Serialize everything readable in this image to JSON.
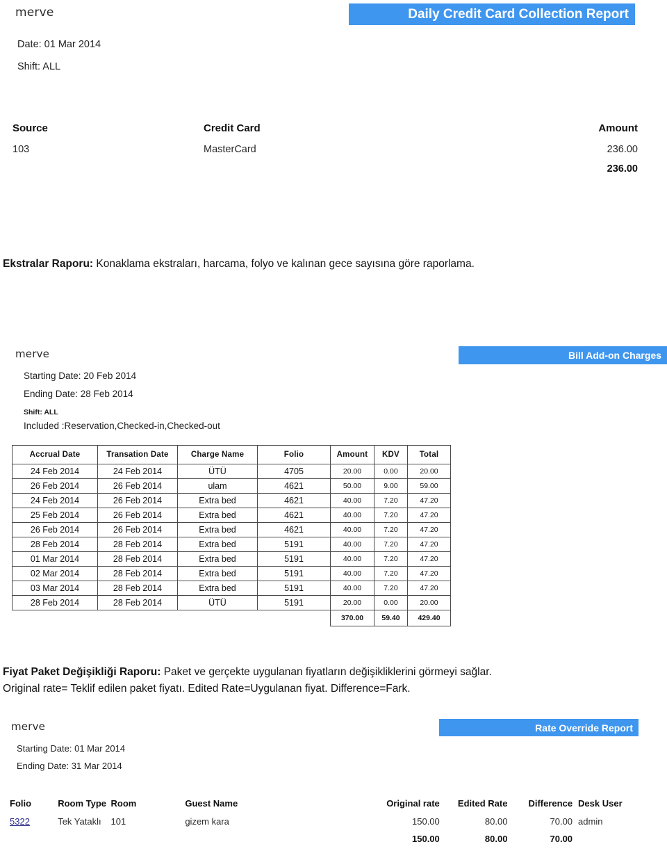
{
  "report1": {
    "logo": "merve",
    "banner_title": "Daily Credit Card Collection Report",
    "date_line": "Date: 01 Mar 2014",
    "shift_line": "Shift: ALL",
    "columns": [
      "Source",
      "Credit Card",
      "Amount"
    ],
    "rows": [
      {
        "source": "103",
        "credit_card": "MasterCard",
        "amount": "236.00"
      }
    ],
    "total_amount": "236.00"
  },
  "paragraph1": {
    "bold_lead": "Ekstralar Raporu:",
    "text": " Konaklama ekstraları, harcama, folyo ve kalınan gece sayısına göre raporlama."
  },
  "report2": {
    "logo": "merve",
    "banner_title": "Bill Add-on Charges",
    "starting_date": "Starting Date: 20 Feb 2014",
    "ending_date": "Ending Date: 28 Feb 2014",
    "shift_line": "Shift: ALL",
    "included_line": "Included :Reservation,Checked-in,Checked-out",
    "columns": [
      "Accrual Date",
      "Transation Date",
      "Charge Name",
      "Folio",
      "Amount",
      "KDV",
      "Total"
    ],
    "rows": [
      [
        "24 Feb 2014",
        "24 Feb 2014",
        "ÜTÜ",
        "4705",
        "20.00",
        "0.00",
        "20.00"
      ],
      [
        "26 Feb 2014",
        "26 Feb 2014",
        "ulam",
        "4621",
        "50.00",
        "9.00",
        "59.00"
      ],
      [
        "24 Feb 2014",
        "26 Feb 2014",
        "Extra bed",
        "4621",
        "40.00",
        "7.20",
        "47.20"
      ],
      [
        "25 Feb 2014",
        "26 Feb 2014",
        "Extra bed",
        "4621",
        "40.00",
        "7.20",
        "47.20"
      ],
      [
        "26 Feb 2014",
        "26 Feb 2014",
        "Extra bed",
        "4621",
        "40.00",
        "7.20",
        "47.20"
      ],
      [
        "28 Feb 2014",
        "28 Feb 2014",
        "Extra bed",
        "5191",
        "40.00",
        "7.20",
        "47.20"
      ],
      [
        "01 Mar 2014",
        "28 Feb 2014",
        "Extra bed",
        "5191",
        "40.00",
        "7.20",
        "47.20"
      ],
      [
        "02 Mar 2014",
        "28 Feb 2014",
        "Extra bed",
        "5191",
        "40.00",
        "7.20",
        "47.20"
      ],
      [
        "03 Mar 2014",
        "28 Feb 2014",
        "Extra bed",
        "5191",
        "40.00",
        "7.20",
        "47.20"
      ],
      [
        "28 Feb 2014",
        "28 Feb 2014",
        "ÜTÜ",
        "5191",
        "20.00",
        "0.00",
        "20.00"
      ]
    ],
    "totals": {
      "amount": "370.00",
      "kdv": "59.40",
      "total": "429.40"
    }
  },
  "paragraph2": {
    "bold_lead": "Fiyat Paket Değişikliği Raporu:",
    "line1": " Paket ve gerçekte uygulanan fiyatların değişikliklerini görmeyi sağlar.",
    "line2": "Original rate= Teklif edilen paket fiyatı. Edited Rate=Uygulanan fiyat. Difference=Fark."
  },
  "report3": {
    "logo": "merve",
    "banner_title": "Rate Override Report",
    "starting_date": "Starting Date: 01 Mar 2014",
    "ending_date": "Ending Date: 31 Mar 2014",
    "columns": [
      "Folio",
      "Room Type",
      "Room",
      "Guest Name",
      "Original rate",
      "Edited Rate",
      "Difference",
      "Desk User"
    ],
    "rows": [
      {
        "folio": "5322",
        "room_type": "Tek Yataklı",
        "room": "101",
        "guest_name": "gizem kara",
        "original_rate": "150.00",
        "edited_rate": "80.00",
        "difference": "70.00",
        "desk_user": "admin"
      }
    ],
    "totals": {
      "original_rate": "150.00",
      "edited_rate": "80.00",
      "difference": "70.00"
    }
  },
  "colors": {
    "banner_blue": "#3f96ef",
    "link_blue": "#2a2a8c",
    "text": "#1a1a1a"
  }
}
